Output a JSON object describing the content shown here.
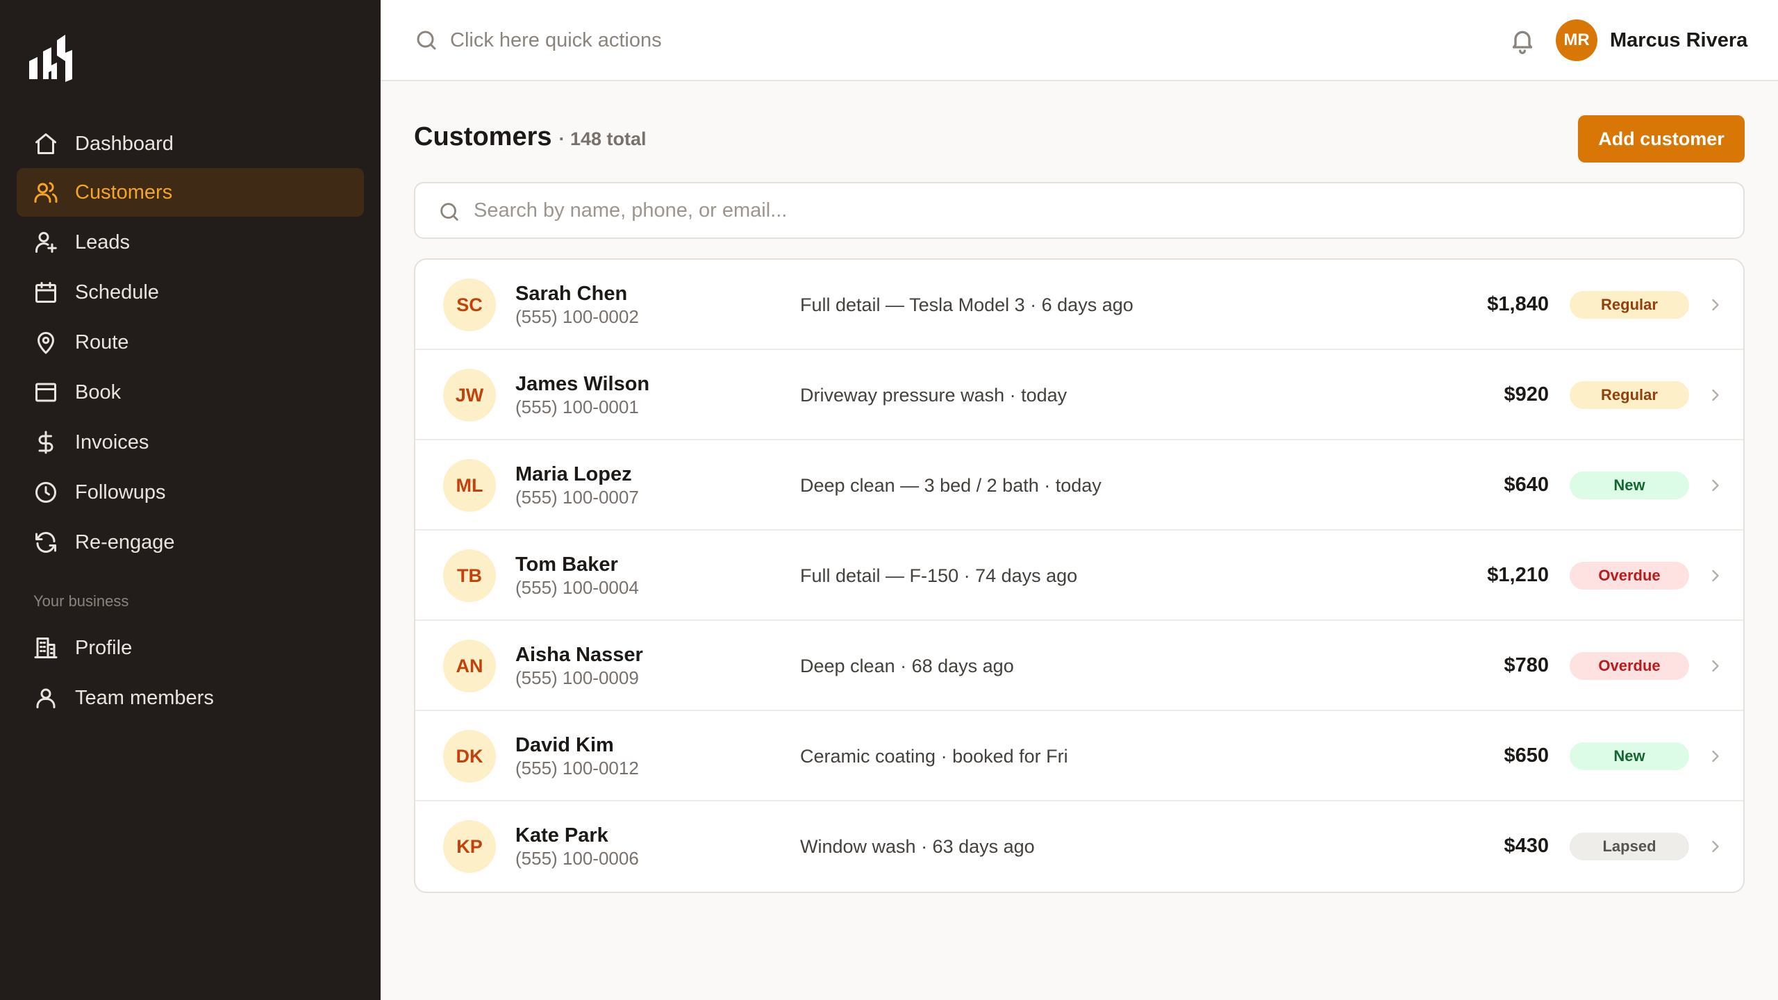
{
  "brand": {
    "logo_icon": "brand-logo",
    "accent": "#d97706"
  },
  "sidebar": {
    "items": [
      {
        "label": "Dashboard",
        "icon": "home-icon"
      },
      {
        "label": "Customers",
        "icon": "users-icon",
        "active": true
      },
      {
        "label": "Leads",
        "icon": "user-plus-icon"
      },
      {
        "label": "Schedule",
        "icon": "calendar-icon"
      },
      {
        "label": "Route",
        "icon": "map-pin-icon"
      },
      {
        "label": "Book",
        "icon": "browser-window-icon"
      },
      {
        "label": "Invoices",
        "icon": "dollar-icon"
      },
      {
        "label": "Followups",
        "icon": "clock-icon"
      },
      {
        "label": "Re-engage",
        "icon": "refresh-icon"
      }
    ],
    "section_label": "Your business",
    "business_items": [
      {
        "label": "Profile",
        "icon": "building-icon"
      },
      {
        "label": "Team members",
        "icon": "user-icon"
      }
    ]
  },
  "topbar": {
    "quick_actions_placeholder": "Click here quick actions",
    "user": {
      "initials": "MR",
      "name": "Marcus Rivera"
    }
  },
  "main": {
    "title": "Customers",
    "count": "· 148 total",
    "add_button": "Add customer",
    "search_placeholder": "Search by name, phone, or email..."
  },
  "customers": [
    {
      "initials": "SC",
      "name": "Sarah Chen",
      "phone": "(555) 100-0002",
      "job": "Full detail — Tesla Model 3 · 6 days ago",
      "amount": "$1,840",
      "status": "Regular",
      "status_kind": "regular"
    },
    {
      "initials": "JW",
      "name": "James Wilson",
      "phone": "(555) 100-0001",
      "job": "Driveway pressure wash · today",
      "amount": "$920",
      "status": "Regular",
      "status_kind": "regular"
    },
    {
      "initials": "ML",
      "name": "Maria Lopez",
      "phone": "(555) 100-0007",
      "job": "Deep clean — 3 bed / 2 bath · today",
      "amount": "$640",
      "status": "New",
      "status_kind": "new"
    },
    {
      "initials": "TB",
      "name": "Tom Baker",
      "phone": "(555) 100-0004",
      "job": "Full detail — F-150 · 74 days ago",
      "amount": "$1,210",
      "status": "Overdue",
      "status_kind": "overdue"
    },
    {
      "initials": "AN",
      "name": "Aisha Nasser",
      "phone": "(555) 100-0009",
      "job": "Deep clean · 68 days ago",
      "amount": "$780",
      "status": "Overdue",
      "status_kind": "overdue"
    },
    {
      "initials": "DK",
      "name": "David Kim",
      "phone": "(555) 100-0012",
      "job": "Ceramic coating · booked for Fri",
      "amount": "$650",
      "status": "New",
      "status_kind": "new"
    },
    {
      "initials": "KP",
      "name": "Kate Park",
      "phone": "(555) 100-0006",
      "job": "Window wash · 63 days ago",
      "amount": "$430",
      "status": "Lapsed",
      "status_kind": "lapsed"
    }
  ]
}
